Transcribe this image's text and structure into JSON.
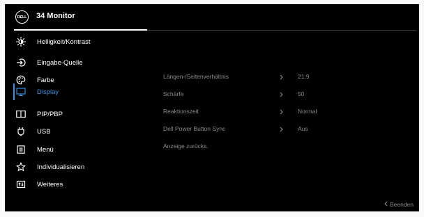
{
  "header": {
    "logo_text": "DELL",
    "title": "34 Monitor"
  },
  "menu": {
    "items": [
      {
        "label": "Helligkeit/Kontrast",
        "icon": "brightness-icon"
      },
      {
        "label": "Eingabe-Quelle",
        "icon": "input-source-icon"
      },
      {
        "label": "Farbe",
        "icon": "color-palette-icon"
      },
      {
        "label": "Display",
        "icon": "display-icon",
        "active": true
      },
      {
        "label": "PIP/PBP",
        "icon": "pip-pbp-icon"
      },
      {
        "label": "USB",
        "icon": "usb-icon"
      },
      {
        "label": "Menü",
        "icon": "menu-icon"
      },
      {
        "label": "Individualisieren",
        "icon": "star-icon"
      },
      {
        "label": "Weiteres",
        "icon": "others-icon"
      }
    ]
  },
  "display_settings": [
    {
      "label": "Längen-/Seitenverhältnis",
      "value": "21:9"
    },
    {
      "label": "Schärfe",
      "value": "50"
    },
    {
      "label": "Reaktionszeit",
      "value": "Normal"
    },
    {
      "label": "Dell Power Button Sync",
      "value": "Aus"
    },
    {
      "label": "Anzeige zurücks.",
      "value": ""
    }
  ],
  "footer": {
    "exit_label": "Beenden"
  },
  "colors": {
    "background": "#000000",
    "accent": "#3a8fe0",
    "text": "#ffffff",
    "muted": "#8a8a8a"
  }
}
